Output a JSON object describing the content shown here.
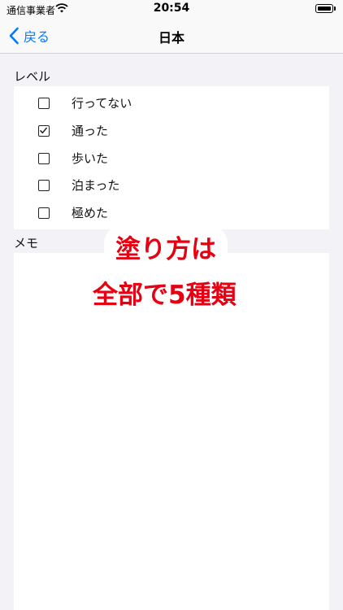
{
  "status_bar": {
    "carrier": "通信事業者",
    "time": "20:54"
  },
  "nav": {
    "back_label": "戻る",
    "title": "日本"
  },
  "level_section": {
    "header": "レベル",
    "items": [
      {
        "label": "行ってない",
        "checked": false
      },
      {
        "label": "通った",
        "checked": true
      },
      {
        "label": "歩いた",
        "checked": false
      },
      {
        "label": "泊まった",
        "checked": false
      },
      {
        "label": "極めた",
        "checked": false
      }
    ]
  },
  "memo_section": {
    "header": "メモ"
  },
  "overlay": {
    "line1": "塗り方は",
    "line2": "全部で5種類"
  },
  "colors": {
    "accent": "#007aff",
    "overlay_text": "#e60012",
    "background": "#f2f2f7"
  }
}
